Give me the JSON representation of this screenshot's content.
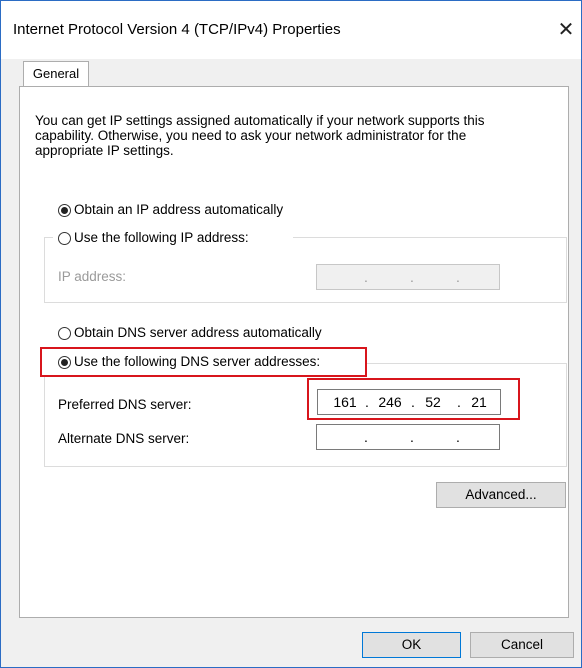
{
  "window": {
    "title": "Internet Protocol Version 4 (TCP/IPv4) Properties",
    "close_glyph": "✕"
  },
  "tabs": [
    {
      "label": "General"
    }
  ],
  "intro_text": "You can get IP settings assigned automatically if your network supports this capability. Otherwise, you need to ask your network administrator for the appropriate IP settings.",
  "ip_section": {
    "auto_label": "Obtain an IP address automatically",
    "manual_label": "Use the following IP address:",
    "selected": "auto",
    "ip_address_label": "IP address:",
    "ip_address_value": [
      "",
      "",
      "",
      ""
    ]
  },
  "dns_section": {
    "auto_label": "Obtain DNS server address automatically",
    "manual_label": "Use the following DNS server addresses:",
    "selected": "manual",
    "preferred_label": "Preferred DNS server:",
    "preferred_value": [
      "161",
      "246",
      "52",
      "21"
    ],
    "alternate_label": "Alternate DNS server:",
    "alternate_value": [
      "",
      "",
      "",
      ""
    ]
  },
  "buttons": {
    "advanced": "Advanced...",
    "ok": "OK",
    "cancel": "Cancel"
  },
  "dot": ".",
  "colors": {
    "highlight": "#d8151c",
    "window_border": "#2b6cc4",
    "default_button": "#0078d7"
  }
}
